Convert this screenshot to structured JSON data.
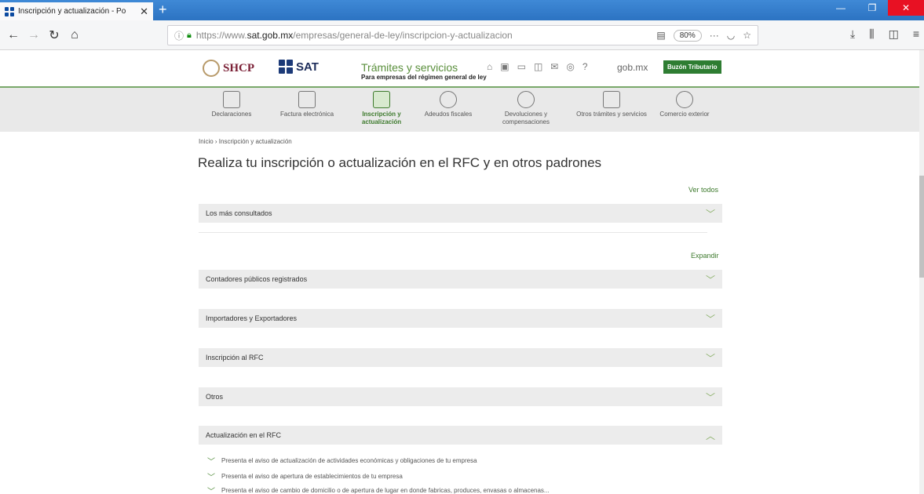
{
  "browser": {
    "tab_title": "Inscripción y actualización - Po",
    "tab_close": "✕",
    "new_tab": "+",
    "url_prefix": "https://www.",
    "url_domain": "sat.gob.mx",
    "url_path": "/empresas/general-de-ley/inscripcion-y-actualizacion",
    "zoom": "80%",
    "more": "···"
  },
  "header": {
    "shcp_label": "SHCP",
    "sat_label": "SAT",
    "title": "Trámites y servicios",
    "subtitle": "Para empresas del régimen general de ley",
    "gobmx": "gob.mx",
    "buzon": "Buzón Tributario"
  },
  "services": [
    {
      "label": "Declaraciones"
    },
    {
      "label": "Factura electrónica"
    },
    {
      "label": "Inscripción y actualización"
    },
    {
      "label": "Adeudos fiscales"
    },
    {
      "label": "Devoluciones y compensaciones"
    },
    {
      "label": "Otros trámites y servicios"
    },
    {
      "label": "Comercio exterior"
    }
  ],
  "breadcrumb": "Inicio › Inscripción y actualización",
  "page_title": "Realiza tu inscripción o actualización en el RFC y en otros padrones",
  "links": {
    "ver_todos": "Ver todos",
    "expandir": "Expandir"
  },
  "accordions": [
    {
      "label": "Los más consultados",
      "chevron": "﹀"
    },
    {
      "label": "Contadores públicos registrados",
      "chevron": "﹀"
    },
    {
      "label": "Importadores y Exportadores",
      "chevron": "﹀"
    },
    {
      "label": "Inscripción al RFC",
      "chevron": "﹀"
    },
    {
      "label": "Otros",
      "chevron": "﹀"
    },
    {
      "label": "Actualización en el RFC",
      "chevron": "︿"
    }
  ],
  "sub_items": [
    "Presenta el aviso de actualización de actividades económicas y obligaciones de tu empresa",
    "Presenta el aviso de apertura de establecimientos de tu empresa",
    "Presenta el aviso de cambio de domicilio o de apertura de lugar en donde fabricas, produces, envasas o almacenas..."
  ],
  "colors": {
    "accent_green": "#3d7a2d",
    "browser_blue": "#2c73c2",
    "close_red": "#e81123"
  }
}
